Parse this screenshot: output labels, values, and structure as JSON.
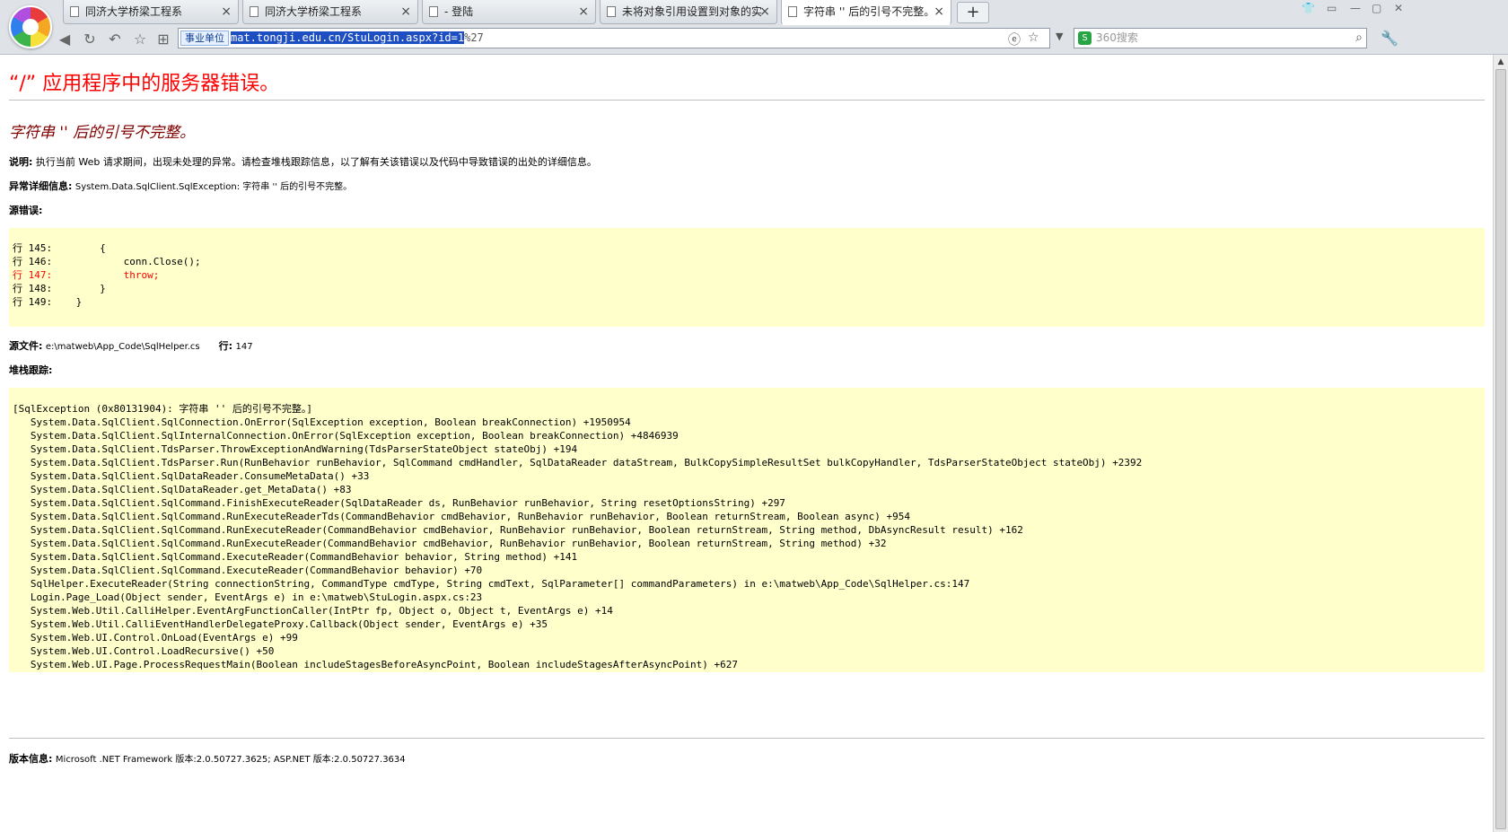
{
  "browser": {
    "tabs": [
      {
        "title": "同济大学桥梁工程系"
      },
      {
        "title": "同济大学桥梁工程系"
      },
      {
        "title": "- 登陆"
      },
      {
        "title": "未将对象引用设置到对象的实"
      },
      {
        "title": "字符串 '' 后的引号不完整。"
      }
    ],
    "new_tab": "+",
    "address": {
      "tag": "事业单位",
      "url_selected": "mat.tongji.edu.cn/StuLogin.aspx?id=1",
      "url_rest": "%27"
    },
    "search": {
      "placeholder": "360搜索",
      "logo": "S"
    },
    "icons": {
      "back": "back-arrow-icon",
      "refresh": "refresh-icon",
      "undo": "undo-icon",
      "favorite": "star-icon",
      "grid": "grid-icon",
      "ie": "ie-mode-icon",
      "bookmark": "star-icon",
      "dropdown": "chevron-down-icon",
      "search": "search-icon",
      "tools": "wrench-icon"
    },
    "colors": {
      "selection": "#1e4fc2",
      "chrome": "#dfe3e8"
    }
  },
  "page": {
    "title": "“/” 应用程序中的服务器错误。",
    "error_heading": "字符串 '' 后的引号不完整。",
    "description_label": "说明:",
    "description_text": "执行当前 Web 请求期间，出现未处理的异常。请检查堆栈跟踪信息，以了解有关该错误以及代码中导致错误的出处的详细信息。",
    "exception_label": "异常详细信息:",
    "exception_text": "System.Data.SqlClient.SqlException: 字符串 '' 后的引号不完整。",
    "source_error_label": "源错误:",
    "source_lines": [
      "行 145:        {",
      "行 146:            conn.Close();"
    ],
    "source_error_line": "行 147:            throw;",
    "source_lines_after": [
      "行 148:        }",
      "行 149:    }"
    ],
    "source_file_label": "源文件:",
    "source_file_value": "e:\\matweb\\App_Code\\SqlHelper.cs",
    "line_label": "行:",
    "line_value": "147",
    "stack_trace_label": "堆栈跟踪:",
    "stack_trace": [
      "[SqlException (0x80131904): 字符串 '' 后的引号不完整。]",
      "   System.Data.SqlClient.SqlConnection.OnError(SqlException exception, Boolean breakConnection) +1950954",
      "   System.Data.SqlClient.SqlInternalConnection.OnError(SqlException exception, Boolean breakConnection) +4846939",
      "   System.Data.SqlClient.TdsParser.ThrowExceptionAndWarning(TdsParserStateObject stateObj) +194",
      "   System.Data.SqlClient.TdsParser.Run(RunBehavior runBehavior, SqlCommand cmdHandler, SqlDataReader dataStream, BulkCopySimpleResultSet bulkCopyHandler, TdsParserStateObject stateObj) +2392",
      "   System.Data.SqlClient.SqlDataReader.ConsumeMetaData() +33",
      "   System.Data.SqlClient.SqlDataReader.get_MetaData() +83",
      "   System.Data.SqlClient.SqlCommand.FinishExecuteReader(SqlDataReader ds, RunBehavior runBehavior, String resetOptionsString) +297",
      "   System.Data.SqlClient.SqlCommand.RunExecuteReaderTds(CommandBehavior cmdBehavior, RunBehavior runBehavior, Boolean returnStream, Boolean async) +954",
      "   System.Data.SqlClient.SqlCommand.RunExecuteReader(CommandBehavior cmdBehavior, RunBehavior runBehavior, Boolean returnStream, String method, DbAsyncResult result) +162",
      "   System.Data.SqlClient.SqlCommand.RunExecuteReader(CommandBehavior cmdBehavior, RunBehavior runBehavior, Boolean returnStream, String method) +32",
      "   System.Data.SqlClient.SqlCommand.ExecuteReader(CommandBehavior behavior, String method) +141",
      "   System.Data.SqlClient.SqlCommand.ExecuteReader(CommandBehavior behavior) +70",
      "   SqlHelper.ExecuteReader(String connectionString, CommandType cmdType, String cmdText, SqlParameter[] commandParameters) in e:\\matweb\\App_Code\\SqlHelper.cs:147",
      "   Login.Page_Load(Object sender, EventArgs e) in e:\\matweb\\StuLogin.aspx.cs:23",
      "   System.Web.Util.CalliHelper.EventArgFunctionCaller(IntPtr fp, Object o, Object t, EventArgs e) +14",
      "   System.Web.Util.CalliEventHandlerDelegateProxy.Callback(Object sender, EventArgs e) +35",
      "   System.Web.UI.Control.OnLoad(EventArgs e) +99",
      "   System.Web.UI.Control.LoadRecursive() +50",
      "   System.Web.UI.Page.ProcessRequestMain(Boolean includeStagesBeforeAsyncPoint, Boolean includeStagesAfterAsyncPoint) +627"
    ],
    "version_label": "版本信息:",
    "version_text": "Microsoft .NET Framework 版本:2.0.50727.3625; ASP.NET 版本:2.0.50727.3634",
    "colors": {
      "title": "#ff0000",
      "heading": "#800000",
      "code_bg": "#ffffcc"
    }
  }
}
